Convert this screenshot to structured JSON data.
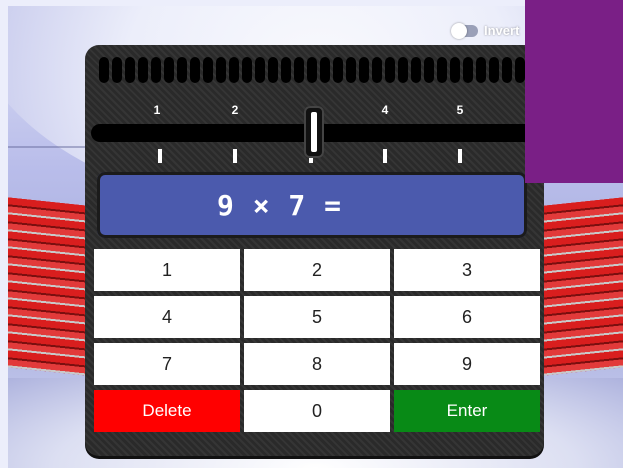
{
  "settings": {
    "invert_label": "Invert"
  },
  "slider": {
    "labels": [
      "1",
      "2",
      "3",
      "4",
      "5"
    ]
  },
  "display": {
    "question": "9 × 7 ="
  },
  "keypad": {
    "keys": [
      "1",
      "2",
      "3",
      "4",
      "5",
      "6",
      "7",
      "8",
      "9"
    ],
    "delete_label": "Delete",
    "zero_label": "0",
    "enter_label": "Enter"
  },
  "colors": {
    "display": "#4b5aad",
    "delete": "#ff0000",
    "enter": "#088a16",
    "panel": "#7a1f86"
  }
}
